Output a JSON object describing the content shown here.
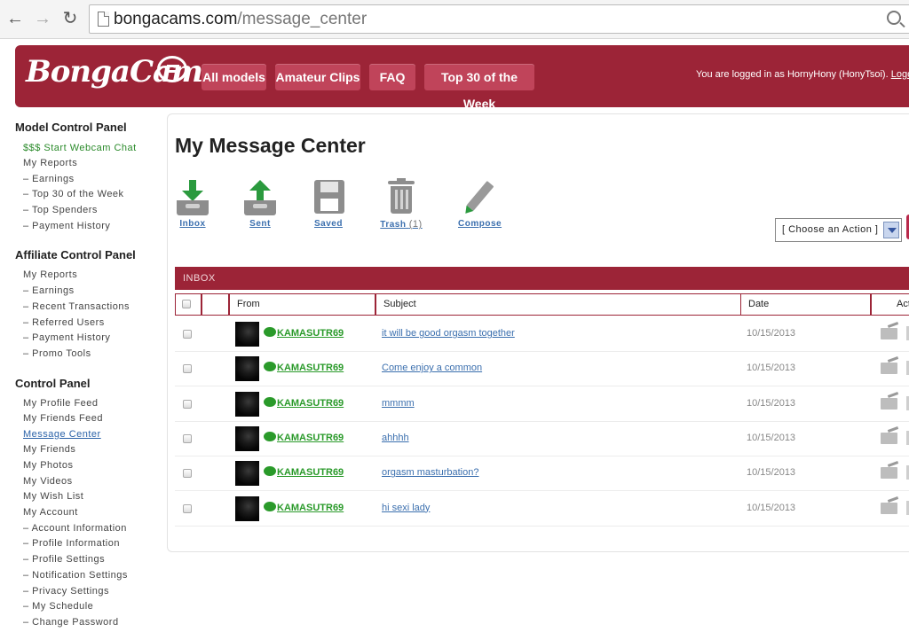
{
  "browser": {
    "url_domain": "bongacams.com",
    "url_path": "/message_center"
  },
  "header": {
    "logo": "BongaCams",
    "nav": [
      "All models",
      "Amateur Clips",
      "FAQ",
      "Top 30 of the Week"
    ],
    "login_prefix": "You are logged in as HornyHony (HonyTsoi).",
    "logout": "Logou"
  },
  "sidebar": {
    "model_panel": {
      "title": "Model Control Panel",
      "items": [
        "$$$ Start Webcam Chat",
        "My Reports",
        "– Earnings",
        "– Top 30 of the Week",
        "– Top Spenders",
        "– Payment History"
      ]
    },
    "affiliate_panel": {
      "title": "Affiliate Control Panel",
      "items": [
        "My Reports",
        "– Earnings",
        "– Recent Transactions",
        "– Referred Users",
        "– Payment History",
        "– Promo Tools"
      ]
    },
    "control_panel": {
      "title": "Control Panel",
      "items": [
        "My Profile Feed",
        "My Friends Feed",
        "Message Center",
        "My Friends",
        "My Photos",
        "My Videos",
        "My Wish List",
        "My Account",
        "– Account Information",
        "– Profile Information",
        "– Profile Settings",
        "– Notification Settings",
        "– Privacy Settings",
        "– My Schedule",
        "– Change Password"
      ]
    }
  },
  "main": {
    "title": "My Message Center",
    "toolbar": {
      "inbox": "Inbox",
      "sent": "Sent",
      "saved": "Saved",
      "trash": "Trash",
      "trash_count": "(1)",
      "compose": "Compose"
    },
    "action_select": "[ Choose an Action ]",
    "inbox_label": "INBOX",
    "columns": {
      "from": "From",
      "subject": "Subject",
      "date": "Date",
      "actions": "Actio"
    },
    "messages": [
      {
        "from": "KAMASUTR69",
        "subject": "it will be good orgasm together",
        "date": "10/15/2013"
      },
      {
        "from": "KAMASUTR69",
        "subject": "Come enjoy a common",
        "date": "10/15/2013"
      },
      {
        "from": "KAMASUTR69",
        "subject": "mmmm",
        "date": "10/15/2013"
      },
      {
        "from": "KAMASUTR69",
        "subject": "ahhhh",
        "date": "10/15/2013"
      },
      {
        "from": "KAMASUTR69",
        "subject": "orgasm masturbation?",
        "date": "10/15/2013"
      },
      {
        "from": "KAMASUTR69",
        "subject": "hi sexi lady",
        "date": "10/15/2013"
      }
    ]
  }
}
